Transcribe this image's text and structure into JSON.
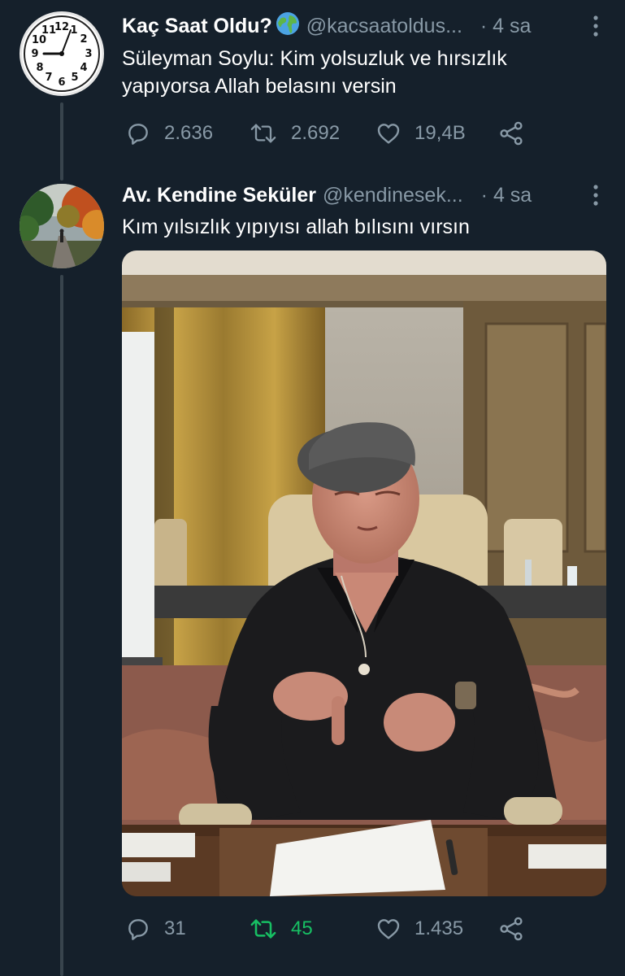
{
  "tweet1": {
    "name": "Kaç Saat Oldu?",
    "handle": "@kacsaatoldus...",
    "time": "· 4 sa",
    "text_line1": "Süleyman Soylu: Kim yolsuzluk ve hırsızlık",
    "text_line2": "yapıyorsa Allah belasını versin",
    "replies": "2.636",
    "retweets": "2.692",
    "likes": "19,4B"
  },
  "tweet2": {
    "name": "Av. Kendine Seküler",
    "handle": "@kendinesek...",
    "time": "· 4 sa",
    "text": "Kım yılsızlık yıpıyısı allah bılısını vırsın",
    "replies": "31",
    "retweets": "45",
    "likes": "1.435"
  },
  "colors": {
    "background": "#15202b",
    "muted": "#8899a6",
    "retweet_active": "#17bf63",
    "thread_line": "#38444d"
  },
  "icons": [
    "clock-avatar",
    "globe-icon",
    "more-icon",
    "reply-icon",
    "retweet-icon",
    "like-icon",
    "share-icon"
  ]
}
